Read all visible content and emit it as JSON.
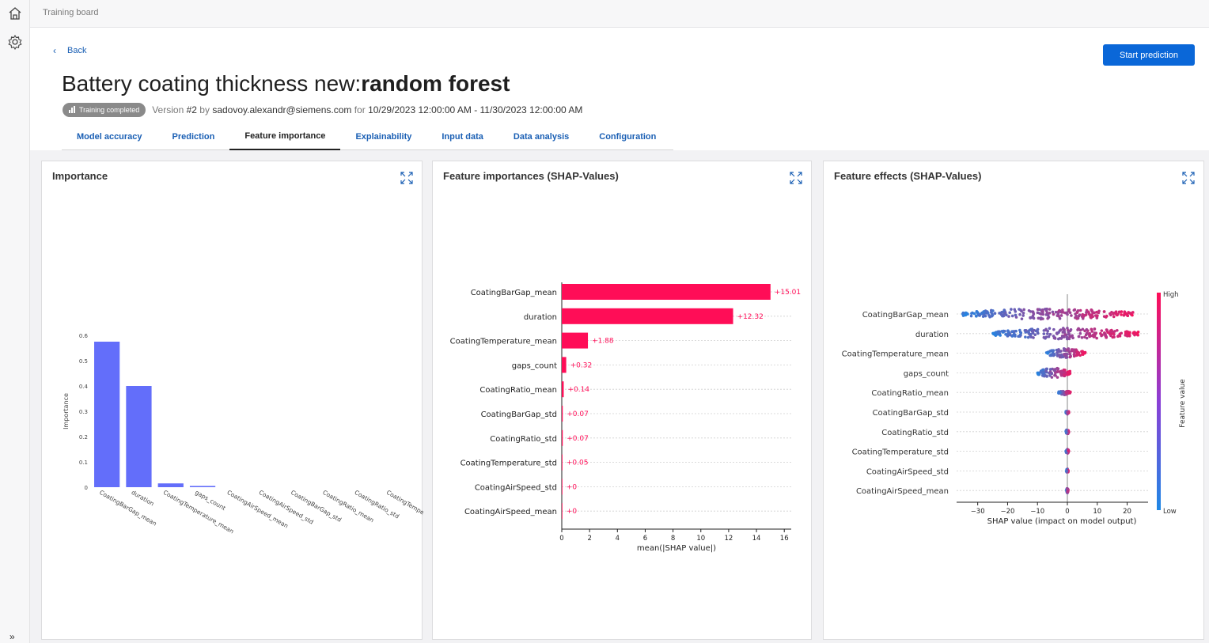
{
  "app": {
    "breadcrumb": "Training board"
  },
  "nav": {
    "back_label": "Back"
  },
  "actions": {
    "start_prediction": "Start prediction"
  },
  "header": {
    "title_prefix": "Battery coating thickness new:",
    "title_model": "random forest",
    "status_badge": "Training completed",
    "version_label": "Version",
    "version_value": "#2",
    "by_label": "by",
    "author": "sadovoy.alexandr@siemens.com",
    "for_label": "for",
    "date_range": "10/29/2023 12:00:00 AM - 11/30/2023 12:00:00 AM"
  },
  "tabs": [
    {
      "label": "Model accuracy",
      "active": false
    },
    {
      "label": "Prediction",
      "active": false
    },
    {
      "label": "Feature importance",
      "active": true
    },
    {
      "label": "Explainability",
      "active": false
    },
    {
      "label": "Input data",
      "active": false
    },
    {
      "label": "Data analysis",
      "active": false
    },
    {
      "label": "Configuration",
      "active": false
    }
  ],
  "panels": {
    "importance": {
      "title": "Importance"
    },
    "shap_importance": {
      "title": "Feature importances (SHAP-Values)"
    },
    "shap_effects": {
      "title": "Feature effects (SHAP-Values)"
    }
  },
  "colors": {
    "accent": "#0a67d8",
    "bar_blue": "#636efa",
    "shap_pink": "#ff0d57",
    "shap_blue": "#1e88e5"
  },
  "chart_data": [
    {
      "type": "bar",
      "ylabel": "Importance",
      "categories": [
        "CoatingBarGap_mean",
        "duration",
        "CoatingTemperature_mean",
        "gaps_count",
        "CoatingAirSpeed_mean",
        "CoatingAirSpeed_std",
        "CoatingBarGap_std",
        "CoatingRatio_mean",
        "CoatingRatio_std",
        "CoatingTemperature_std"
      ],
      "values": [
        0.575,
        0.4,
        0.015,
        0.005,
        0.0,
        0.0,
        0.0,
        0.0,
        0.0,
        0.0
      ],
      "ylim": [
        0,
        0.6
      ],
      "yticks": [
        "0",
        "0.1",
        "0.2",
        "0.3",
        "0.4",
        "0.5",
        "0.6"
      ],
      "color": "#636efa"
    },
    {
      "type": "bar",
      "orientation": "horizontal",
      "xlabel": "mean(|SHAP value|)",
      "categories": [
        "CoatingBarGap_mean",
        "duration",
        "CoatingTemperature_mean",
        "gaps_count",
        "CoatingRatio_mean",
        "CoatingBarGap_std",
        "CoatingRatio_std",
        "CoatingTemperature_std",
        "CoatingAirSpeed_std",
        "CoatingAirSpeed_mean"
      ],
      "values": [
        15.01,
        12.32,
        1.88,
        0.32,
        0.14,
        0.07,
        0.07,
        0.05,
        0,
        0
      ],
      "labels": [
        "+15.01",
        "+12.32",
        "+1.88",
        "+0.32",
        "+0.14",
        "+0.07",
        "+0.07",
        "+0.05",
        "+0",
        "+0"
      ],
      "xlim": [
        0,
        16.5
      ],
      "xticks": [
        "0",
        "2",
        "4",
        "6",
        "8",
        "10",
        "12",
        "14",
        "16"
      ],
      "color": "#ff0d57"
    },
    {
      "type": "scatter",
      "subtype": "beeswarm",
      "xlabel": "SHAP value (impact on model output)",
      "colorbar_label": "Feature value",
      "colorbar_high": "High",
      "colorbar_low": "Low",
      "xlim": [
        -36,
        27
      ],
      "xticks": [
        "−30",
        "−20",
        "−10",
        "0",
        "10",
        "20"
      ],
      "features": [
        {
          "name": "CoatingBarGap_mean",
          "range": [
            -35,
            22
          ]
        },
        {
          "name": "duration",
          "range": [
            -25,
            24
          ]
        },
        {
          "name": "CoatingTemperature_mean",
          "range": [
            -7,
            6
          ]
        },
        {
          "name": "gaps_count",
          "range": [
            -10,
            1
          ]
        },
        {
          "name": "CoatingRatio_mean",
          "range": [
            -3,
            1
          ]
        },
        {
          "name": "CoatingBarGap_std",
          "range": [
            -0.5,
            0.5
          ]
        },
        {
          "name": "CoatingRatio_std",
          "range": [
            -0.5,
            0.5
          ]
        },
        {
          "name": "CoatingTemperature_std",
          "range": [
            -0.5,
            0.5
          ]
        },
        {
          "name": "CoatingAirSpeed_std",
          "range": [
            -0.3,
            0.3
          ]
        },
        {
          "name": "CoatingAirSpeed_mean",
          "range": [
            -0.3,
            0.3
          ]
        }
      ]
    }
  ]
}
